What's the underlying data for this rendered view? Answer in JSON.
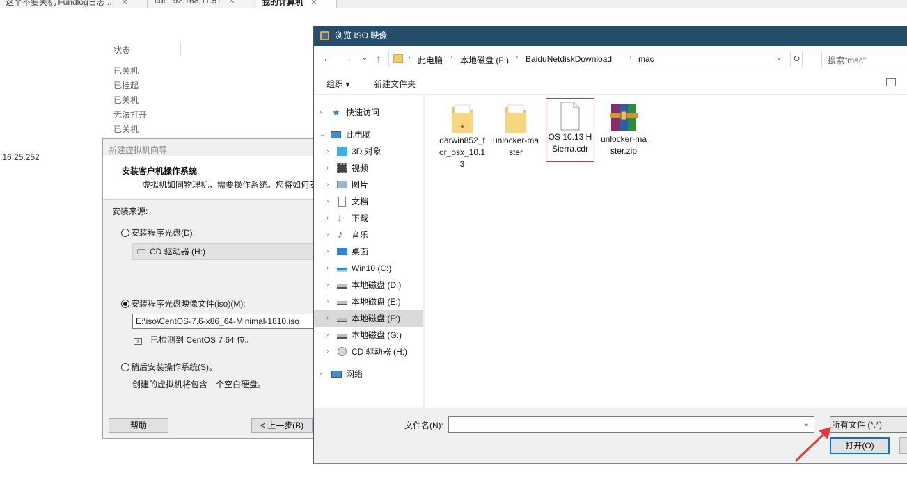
{
  "tabs": [
    {
      "label": "这个不要关机 Fundlog日志 ..."
    },
    {
      "label": "cdr 192.168.11.51"
    },
    {
      "label": "我的计算机"
    }
  ],
  "background": {
    "status_header": "状态",
    "status_rows": [
      "已关机",
      "已挂起",
      "已关机",
      "无法打开",
      "已关机"
    ],
    "ip_fragment": ".16.25.252"
  },
  "wizard": {
    "title": "新建虚拟机向导",
    "heading": "安装客户机操作系统",
    "subheading": "虚拟机如同物理机，需要操作系统。您将如何安",
    "source_label": "安装来源:",
    "option_disc": "安装程序光盘(D):",
    "cd_drive": "CD 驱动器 (H:)",
    "option_iso": "安装程序光盘映像文件(iso)(M):",
    "iso_path": "E:\\iso\\CentOS-7.6-x86_64-Minimal-1810.iso",
    "detected": "已检测到 CentOS 7 64 位。",
    "option_later": "稍后安装操作系统(S)。",
    "later_desc": "创建的虚拟机将包含一个空白硬盘。",
    "help_button": "帮助",
    "back_button": "< 上一步(B)"
  },
  "dialog": {
    "title": "浏览 ISO 映像",
    "breadcrumb": [
      "此电脑",
      "本地磁盘 (F:)",
      "BaiduNetdiskDownload",
      "mac"
    ],
    "search_placeholder": "搜索\"mac\"",
    "organize": "组织 ▾",
    "new_folder": "新建文件夹",
    "nav": [
      {
        "label": "快速访问",
        "icon": "star-icon",
        "level": 0
      },
      {
        "label": "此电脑",
        "icon": "computer-icon",
        "level": 0
      },
      {
        "label": "3D 对象",
        "icon": "cube-icon",
        "level": 1
      },
      {
        "label": "视频",
        "icon": "video-icon",
        "level": 1
      },
      {
        "label": "图片",
        "icon": "picture-icon",
        "level": 1
      },
      {
        "label": "文档",
        "icon": "document-icon",
        "level": 1
      },
      {
        "label": "下载",
        "icon": "download-icon",
        "level": 1
      },
      {
        "label": "音乐",
        "icon": "music-icon",
        "level": 1
      },
      {
        "label": "桌面",
        "icon": "desktop-icon",
        "level": 1
      },
      {
        "label": "Win10 (C:)",
        "icon": "windows-drive-icon",
        "level": 1
      },
      {
        "label": "本地磁盘 (D:)",
        "icon": "drive-icon",
        "level": 1
      },
      {
        "label": "本地磁盘 (E:)",
        "icon": "drive-icon",
        "level": 1
      },
      {
        "label": "本地磁盘 (F:)",
        "icon": "drive-icon",
        "level": 1,
        "selected": true
      },
      {
        "label": "本地磁盘 (G:)",
        "icon": "drive-icon",
        "level": 1
      },
      {
        "label": "CD 驱动器 (H:)",
        "icon": "cd-drive-icon",
        "level": 1
      },
      {
        "label": "网络",
        "icon": "network-icon",
        "level": 0
      }
    ],
    "files": [
      {
        "name": "darwin852_for_osx_10.13",
        "type": "folder"
      },
      {
        "name": "unlocker-master",
        "type": "folder"
      },
      {
        "name": "OS 10.13 HSierra.cdr",
        "type": "file",
        "highlighted": true
      },
      {
        "name": "unlocker-master.zip",
        "type": "archive"
      }
    ],
    "filename_label": "文件名(N):",
    "filename_value": "",
    "filetype": "所有文件 (*.*)",
    "open_button": "打开(O)"
  },
  "colors": {
    "title_bar": "#264e6c",
    "annotation_red": "#e53935",
    "selection": "#d9d9d9",
    "focus_blue": "#0078d7"
  }
}
